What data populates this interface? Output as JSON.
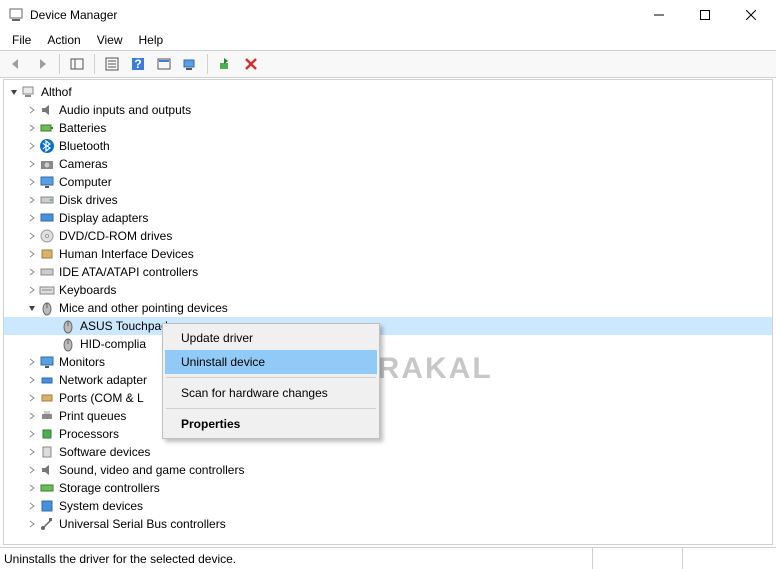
{
  "window": {
    "title": "Device Manager"
  },
  "menu": {
    "file": "File",
    "action": "Action",
    "view": "View",
    "help": "Help"
  },
  "root": {
    "name": "Althof"
  },
  "categories": [
    {
      "key": "audio",
      "label": "Audio inputs and outputs"
    },
    {
      "key": "batteries",
      "label": "Batteries"
    },
    {
      "key": "bluetooth",
      "label": "Bluetooth"
    },
    {
      "key": "cameras",
      "label": "Cameras"
    },
    {
      "key": "computer",
      "label": "Computer"
    },
    {
      "key": "disk",
      "label": "Disk drives"
    },
    {
      "key": "display",
      "label": "Display adapters"
    },
    {
      "key": "dvd",
      "label": "DVD/CD-ROM drives"
    },
    {
      "key": "hid",
      "label": "Human Interface Devices"
    },
    {
      "key": "ide",
      "label": "IDE ATA/ATAPI controllers"
    },
    {
      "key": "keyboards",
      "label": "Keyboards"
    },
    {
      "key": "mice",
      "label": "Mice and other pointing devices",
      "expanded": true,
      "children": [
        {
          "key": "asus-touchpad",
          "label": "ASUS Touchpad",
          "selected": true
        },
        {
          "key": "hid-mouse",
          "label": "HID-compliant mouse",
          "truncated": "HID-complia"
        }
      ]
    },
    {
      "key": "monitors",
      "label": "Monitors"
    },
    {
      "key": "network",
      "label": "Network adapters",
      "truncated": "Network adapter"
    },
    {
      "key": "ports",
      "label": "Ports (COM & LPT)",
      "truncated": "Ports (COM & L"
    },
    {
      "key": "print",
      "label": "Print queues"
    },
    {
      "key": "processors",
      "label": "Processors"
    },
    {
      "key": "software",
      "label": "Software devices"
    },
    {
      "key": "sound",
      "label": "Sound, video and game controllers"
    },
    {
      "key": "storage",
      "label": "Storage controllers"
    },
    {
      "key": "system",
      "label": "System devices"
    },
    {
      "key": "usb",
      "label": "Universal Serial Bus controllers"
    }
  ],
  "context_menu": {
    "update": "Update driver",
    "uninstall": "Uninstall device",
    "scan": "Scan for hardware changes",
    "properties": "Properties"
  },
  "status": {
    "text": "Uninstalls the driver for the selected device."
  },
  "watermark": "BERAKAL"
}
